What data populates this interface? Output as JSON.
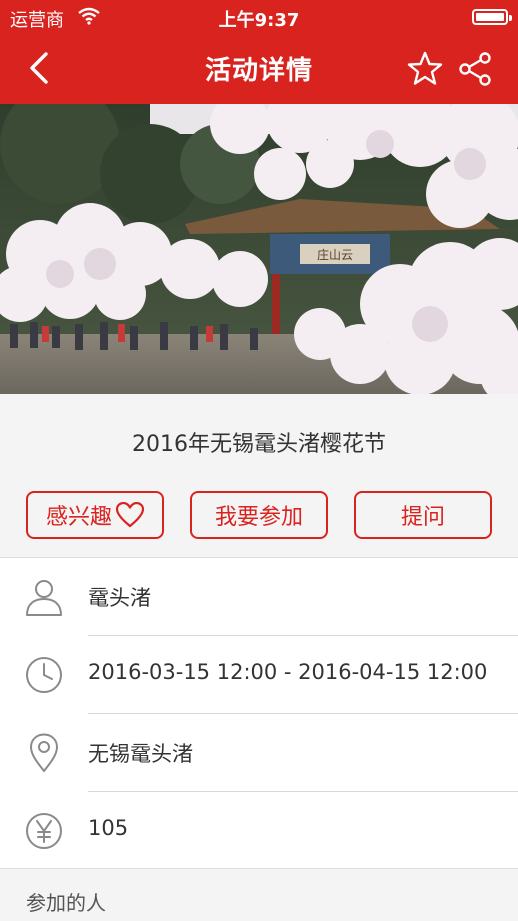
{
  "status_bar": {
    "carrier": "运营商",
    "time": "上午9:37"
  },
  "nav": {
    "title": "活动详情"
  },
  "event": {
    "title": "2016年无锡鼋头渚樱花节"
  },
  "actions": {
    "interested": "感兴趣",
    "join": "我要参加",
    "ask": "提问"
  },
  "details": {
    "organizer": "鼋头渚",
    "time_range": "2016-03-15 12:00 - 2016-04-15 12:00",
    "location": "无锡鼋头渚",
    "price": "105"
  },
  "participants": {
    "label": "参加的人"
  },
  "colors": {
    "brand_red": "#d9231f"
  },
  "icons": [
    "chevron-left-icon",
    "star-icon",
    "share-icon",
    "heart-icon",
    "user-icon",
    "clock-icon",
    "location-pin-icon",
    "yen-icon",
    "wifi-icon",
    "battery-icon"
  ]
}
